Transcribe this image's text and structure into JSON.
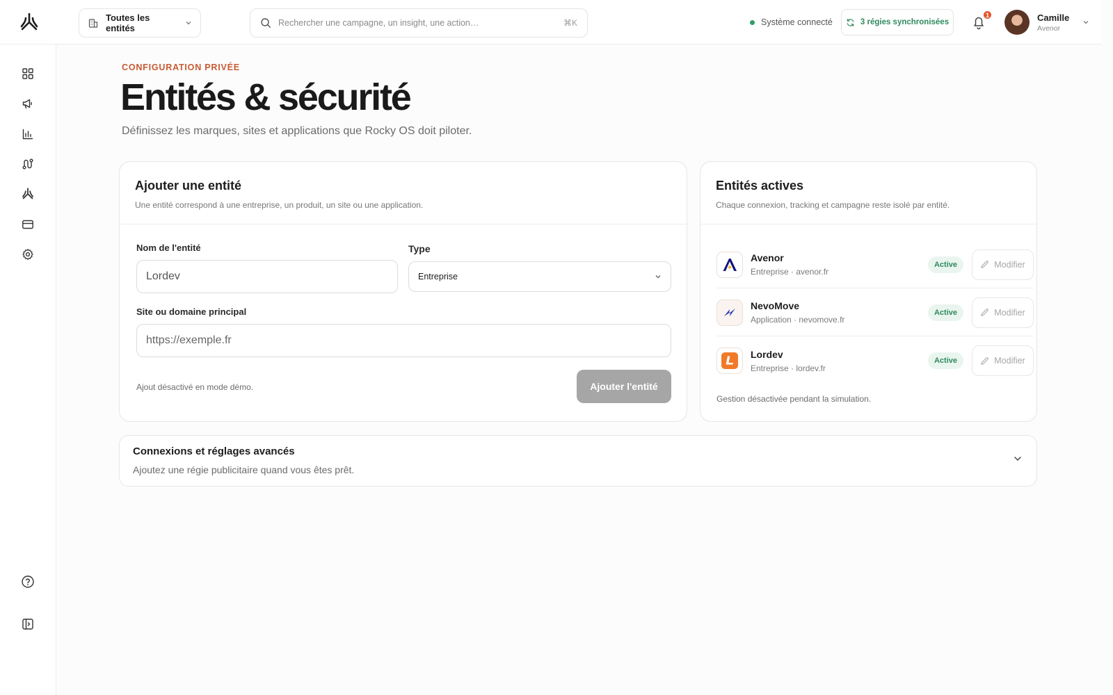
{
  "header": {
    "entity_selector": {
      "label": "Toutes les entités",
      "icon": "building-icon"
    },
    "search": {
      "placeholder": "Rechercher une campagne, un insight, une action…",
      "shortcut": "⌘K"
    },
    "system_status": {
      "label": "Système connecté",
      "color": "#2f9e6a"
    },
    "sync_button": {
      "label": "3 régies synchronisées",
      "color": "#2e8a5c"
    },
    "notifications": {
      "count": "1",
      "badge_color": "#e2582f"
    },
    "user": {
      "name": "Camille",
      "org": "Avenor"
    }
  },
  "sidebar": {
    "items": [
      {
        "name": "dashboard-icon"
      },
      {
        "name": "megaphone-icon"
      },
      {
        "name": "bar-chart-icon"
      },
      {
        "name": "route-icon"
      },
      {
        "name": "rocky-logo-icon"
      },
      {
        "name": "credit-card-icon"
      },
      {
        "name": "settings-icon"
      }
    ],
    "bottom": [
      {
        "name": "help-icon"
      },
      {
        "name": "collapse-sidebar-icon"
      }
    ]
  },
  "page": {
    "eyebrow": "CONFIGURATION PRIVÉE",
    "title": "Entités & sécurité",
    "subtitle": "Définissez les marques, sites et applications que Rocky OS doit piloter."
  },
  "add_entity": {
    "title": "Ajouter une entité",
    "description": "Une entité correspond à une entreprise, un produit, un site ou une application.",
    "name_label": "Nom de l'entité",
    "name_value": "Lordev",
    "type_label": "Type",
    "type_value": "Entreprise",
    "domain_label": "Site ou domaine principal",
    "domain_placeholder": "https://exemple.fr",
    "demo_note": "Ajout désactivé en mode démo.",
    "submit_label": "Ajouter l'entité"
  },
  "active_entities": {
    "title": "Entités actives",
    "description": "Chaque connexion, tracking et campagne reste isolé par entité.",
    "items": [
      {
        "name": "Avenor",
        "meta": "Entreprise · avenor.fr",
        "status": "Active",
        "action": "Modifier",
        "logo": "avenor-logo"
      },
      {
        "name": "NevoMove",
        "meta": "Application · nevomove.fr",
        "status": "Active",
        "action": "Modifier",
        "logo": "nevomove-logo"
      },
      {
        "name": "Lordev",
        "meta": "Entreprise · lordev.fr",
        "status": "Active",
        "action": "Modifier",
        "logo": "lordev-logo"
      }
    ],
    "note": "Gestion désactivée pendant la simulation."
  },
  "advanced": {
    "title": "Connexions et réglages avancés",
    "subtitle": "Ajoutez une régie publicitaire quand vous êtes prêt."
  },
  "colors": {
    "accent": "#c85a32",
    "active_green": "#2e8a5c",
    "disabled_button": "#a6a6a6"
  }
}
